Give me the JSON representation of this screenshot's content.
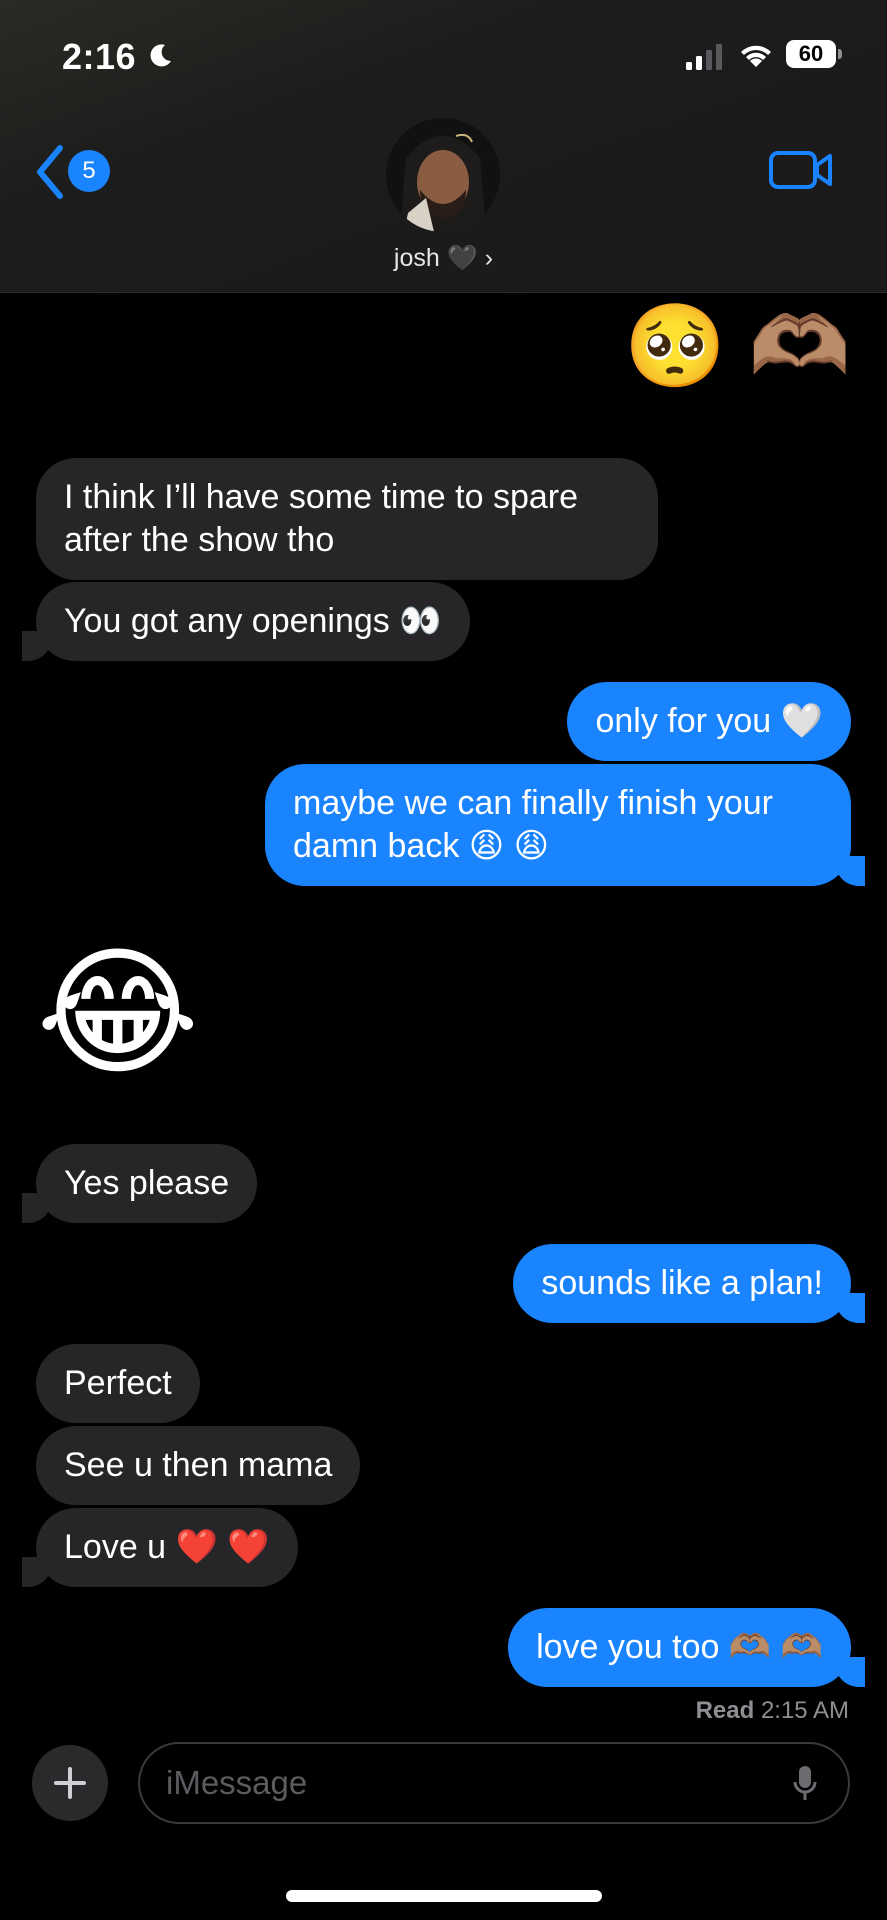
{
  "status": {
    "time": "2:16",
    "battery": "60"
  },
  "header": {
    "back_count": "5",
    "contact_name": "josh 🖤 ›"
  },
  "messages": {
    "m0": "🥺 🫶🏽",
    "m1": "I think I’ll have some time to spare\nafter the show tho",
    "m2": "You got any openings 👀",
    "m3": "only for you 🤍",
    "m4": "maybe we can finally finish your\ndamn back 😩 😩",
    "m5": "😂",
    "m6": "Yes please",
    "m7": "sounds like a plan!",
    "m8": "Perfect",
    "m9": "See u then mama",
    "m10": "Love u ❤️ ❤️",
    "m11": "love you too 🫶🏽 🫶🏽"
  },
  "receipt": {
    "label": "Read",
    "time": "2:15 AM"
  },
  "composer": {
    "placeholder": "iMessage"
  },
  "colors": {
    "accent": "#1a84ff",
    "incoming_bubble": "#262628"
  }
}
